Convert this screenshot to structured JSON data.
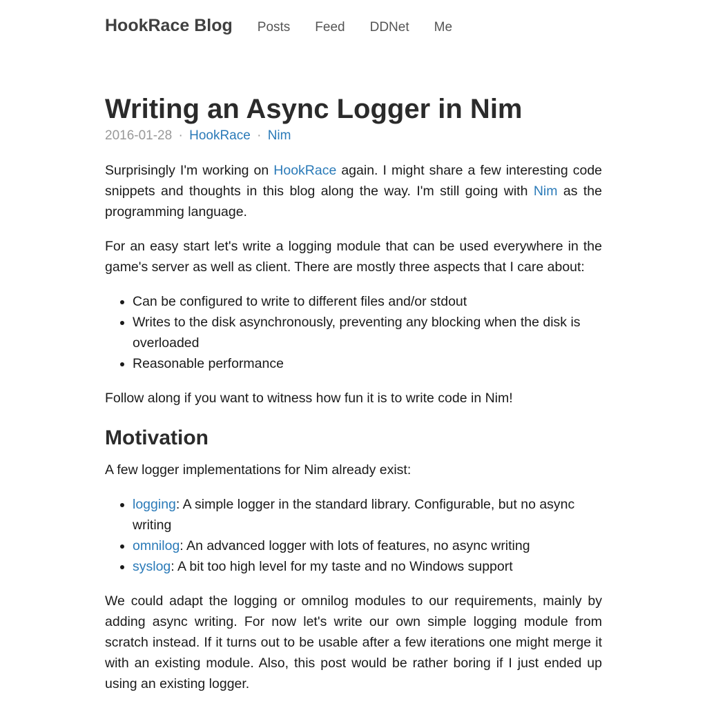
{
  "nav": {
    "brand": "HookRace Blog",
    "links": [
      "Posts",
      "Feed",
      "DDNet",
      "Me"
    ]
  },
  "post": {
    "title": "Writing an Async Logger in Nim",
    "date": "2016-01-28",
    "separator": "·",
    "tags": [
      "HookRace",
      "Nim"
    ]
  },
  "intro": {
    "p1_before": "Surprisingly I'm working on ",
    "p1_link1": "HookRace",
    "p1_mid": " again. I might share a few interesting code snippets and thoughts in this blog along the way. I'm still going with ",
    "p1_link2": "Nim",
    "p1_after": " as the programming language.",
    "p2": "For an easy start let's write a logging module that can be used everywhere in the game's server as well as client. There are mostly three aspects that I care about:",
    "aspects": [
      "Can be configured to write to different files and/or stdout",
      "Writes to the disk asynchronously, preventing any blocking when the disk is overloaded",
      "Reasonable performance"
    ],
    "p3": "Follow along if you want to witness how fun it is to write code in Nim!"
  },
  "motivation": {
    "heading": "Motivation",
    "p1": "A few logger implementations for Nim already exist:",
    "loggers": [
      {
        "name": "logging",
        "desc": ": A simple logger in the standard library. Configurable, but no async writing"
      },
      {
        "name": "omnilog",
        "desc": ": An advanced logger with lots of features, no async writing"
      },
      {
        "name": "syslog",
        "desc": ": A bit too high level for my taste and no Windows support"
      }
    ],
    "p2": "We could adapt the logging or omnilog modules to our requirements, mainly by adding async writing. For now let's write our own simple logging module from scratch instead. If it turns out to be usable after a few iterations one might merge it with an existing module. Also, this post would be rather boring if I just ended up using an existing logger."
  }
}
